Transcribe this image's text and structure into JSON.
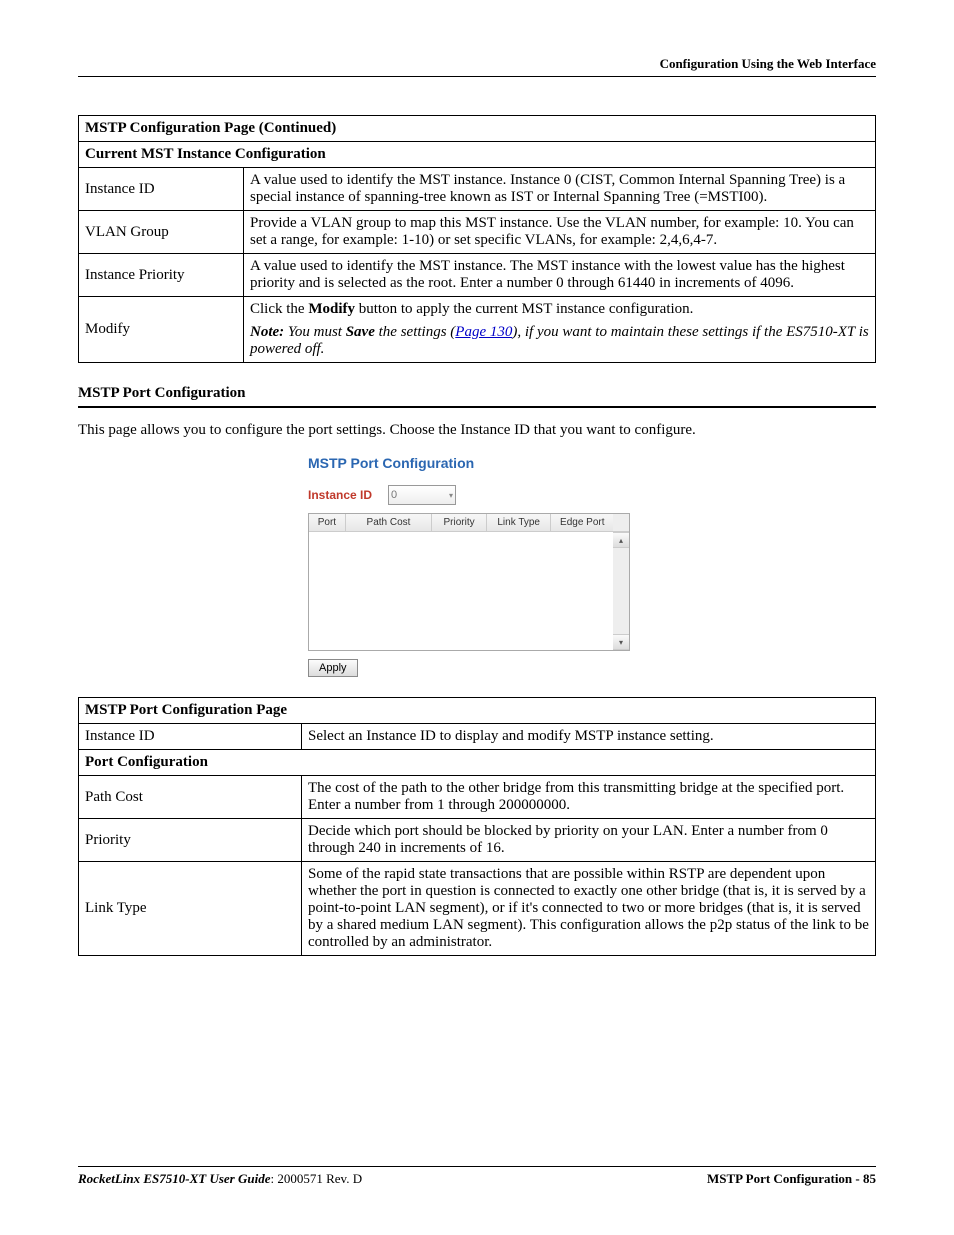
{
  "header": {
    "title": "Configuration Using the Web Interface"
  },
  "table1": {
    "title": "MSTP Configuration Page  (Continued)",
    "section": "Current MST Instance Configuration",
    "rows": [
      {
        "label": "Instance ID",
        "desc": "A value used to identify the MST instance. Instance 0 (CIST, Common Internal Spanning Tree) is a special instance of spanning-tree known as IST or Internal Spanning Tree (=MSTI00)."
      },
      {
        "label": "VLAN Group",
        "desc": "Provide a VLAN group to map this MST instance. Use the VLAN number, for example: 10. You can set a range, for example: 1-10) or set specific VLANs, for example: 2,4,6,4-7."
      },
      {
        "label": "Instance Priority",
        "desc": "A value used to identify the MST instance. The MST instance with the lowest value has the highest priority and is selected as the root. Enter a number 0 through 61440 in increments of 4096."
      },
      {
        "label": "Modify",
        "desc_line1_pre": "Click the ",
        "desc_line1_strong": "Modify",
        "desc_line1_post": " button to apply the current MST instance configuration.",
        "note_label": "Note:",
        "note_pre": "  You must ",
        "note_save": "Save",
        "note_mid": " the settings (",
        "note_link": "Page 130",
        "note_post": "), if you want to maintain these settings if the ES7510-XT is powered off."
      }
    ]
  },
  "section2": {
    "title": "MSTP Port Configuration",
    "para": "This page allows you to configure the port settings. Choose the Instance ID that you want to configure."
  },
  "ui": {
    "title": "MSTP Port Configuration",
    "instance_label": "Instance ID",
    "instance_value": "0",
    "cols": {
      "port": "Port",
      "path_cost": "Path Cost",
      "priority": "Priority",
      "link_type": "Link Type",
      "edge_port": "Edge Port"
    },
    "apply": "Apply"
  },
  "table2": {
    "title": "MSTP Port Configuration Page",
    "row_instance": {
      "label": "Instance ID",
      "desc": "Select an Instance ID to display and modify MSTP instance setting."
    },
    "section": "Port Configuration",
    "rows": [
      {
        "label": "Path Cost",
        "desc": "The cost of the path to the other bridge from this transmitting bridge at the specified port. Enter a number from 1 through 200000000."
      },
      {
        "label": "Priority",
        "desc": "Decide which port should be blocked by priority on your LAN. Enter a number from 0 through 240 in increments of 16."
      },
      {
        "label": "Link Type",
        "desc": "Some of the rapid state transactions that are possible within RSTP are dependent upon whether the port in question is connected to exactly one other bridge (that is, it is served by a point-to-point LAN segment), or if it's connected to two or more bridges (that is, it is served by a shared medium LAN segment). This configuration allows the p2p status of the link to be controlled by an administrator."
      }
    ]
  },
  "footer": {
    "left_strong": "RocketLinx ES7510-XT  User Guide",
    "left_rest": ": 2000571 Rev. D",
    "right": "MSTP Port Configuration - 85"
  }
}
